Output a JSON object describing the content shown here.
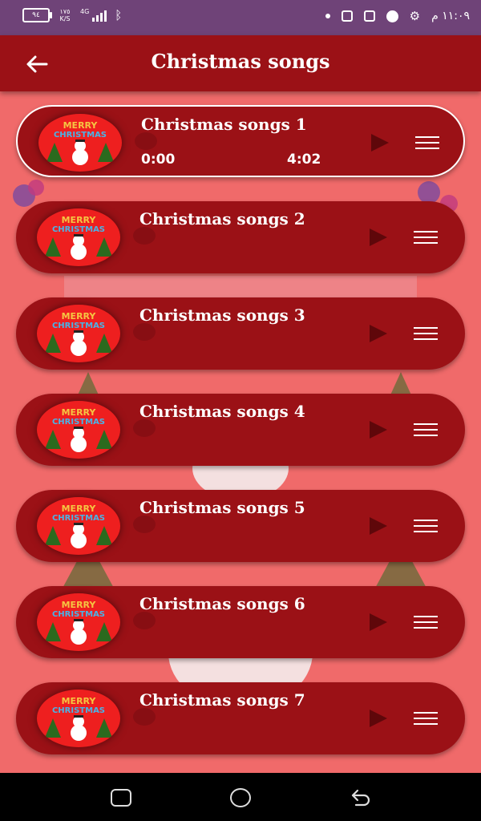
{
  "status_bar": {
    "battery_label": "٩٤",
    "net_speed": "١٧٥\nK/S",
    "network_type": "4G",
    "time": "١١:٠٩ م",
    "icons": [
      "battery-icon",
      "signal-icon",
      "bluetooth-icon",
      "notification-dot-icon",
      "p-app-icon",
      "gamepad-icon",
      "facebook-icon",
      "settings-gear-icon"
    ]
  },
  "app_bar": {
    "title": "Christmas songs",
    "back_icon": "back-arrow-icon"
  },
  "songs": [
    {
      "title": "Christmas songs 1",
      "current_time": "0:00",
      "duration": "4:02",
      "active": true
    },
    {
      "title": "Christmas songs 2",
      "active": false
    },
    {
      "title": "Christmas songs 3",
      "active": false
    },
    {
      "title": "Christmas songs 4",
      "active": false
    },
    {
      "title": "Christmas songs 5",
      "active": false
    },
    {
      "title": "Christmas songs 6",
      "active": false
    },
    {
      "title": "Christmas songs 7",
      "active": false
    }
  ],
  "thumbnail": {
    "line1": "MERRY",
    "line2": "CHRISTMAS"
  },
  "colors": {
    "status_bar": "#6f4378",
    "app_bar": "#9b1116",
    "background": "#f06a6a",
    "card": "#9b1116",
    "play_icon": "#5f070a"
  },
  "nav_bar": {
    "icons": [
      "recent-apps-icon",
      "home-icon",
      "back-icon"
    ]
  }
}
